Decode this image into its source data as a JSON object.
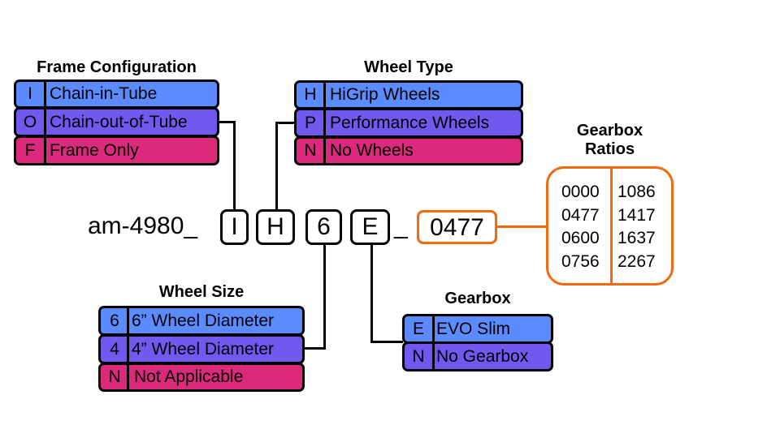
{
  "prefix": "am-4980_",
  "separator": "_",
  "codes": {
    "frame": "I",
    "wheel_type": "H",
    "wheel_size": "6",
    "gearbox": "E",
    "ratio": "0477"
  },
  "frame_configuration": {
    "title": "Frame Configuration",
    "options": [
      {
        "code": "I",
        "label": "Chain-in-Tube",
        "color": "#5c8bff"
      },
      {
        "code": "O",
        "label": "Chain-out-of-Tube",
        "color": "#7258ee"
      },
      {
        "code": "F",
        "label": "Frame Only",
        "color": "#db2a7b"
      }
    ]
  },
  "wheel_type": {
    "title": "Wheel Type",
    "options": [
      {
        "code": "H",
        "label": "HiGrip Wheels",
        "color": "#5c8bff"
      },
      {
        "code": "P",
        "label": "Performance Wheels",
        "color": "#7258ee"
      },
      {
        "code": "N",
        "label": "No Wheels",
        "color": "#db2a7b"
      }
    ]
  },
  "wheel_size": {
    "title": "Wheel Size",
    "options": [
      {
        "code": "6",
        "label": "6” Wheel Diameter",
        "color": "#5c8bff"
      },
      {
        "code": "4",
        "label": "4” Wheel Diameter",
        "color": "#7258ee"
      },
      {
        "code": "N",
        "label": "Not Applicable",
        "color": "#db2a7b"
      }
    ]
  },
  "gearbox": {
    "title": "Gearbox",
    "options": [
      {
        "code": "E",
        "label": "EVO Slim",
        "color": "#5c8bff"
      },
      {
        "code": "N",
        "label": "No Gearbox",
        "color": "#7258ee"
      }
    ]
  },
  "gearbox_ratios": {
    "title_line1": "Gearbox",
    "title_line2": "Ratios",
    "accent_color": "#f26a0f",
    "left_column": [
      "0000",
      "0477",
      "0600",
      "0756"
    ],
    "right_column": [
      "1086",
      "1417",
      "1637",
      "2267"
    ]
  }
}
